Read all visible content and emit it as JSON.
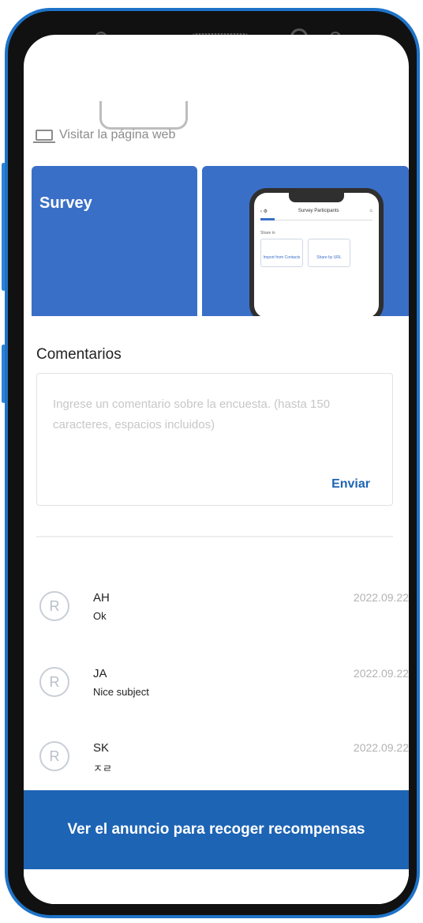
{
  "colors": {
    "accent": "#1d64b4",
    "card": "#3a6fc8",
    "frame": "#1e73c8"
  },
  "header": {
    "visit_link": "Visitar la página web"
  },
  "cards": {
    "survey_title": "Survey",
    "preview": {
      "title": "Survey Participants",
      "share_in": "Share in",
      "import_label": "Import from Contacts",
      "url_label": "Share by URL"
    }
  },
  "comments_section": {
    "title": "Comentarios",
    "placeholder": "Ingrese un comentario sobre la encuesta. (hasta 150 caracteres, espacios incluidos)",
    "send_label": "Enviar"
  },
  "comments": [
    {
      "avatar": "R",
      "name": "AH",
      "text": "Ok",
      "date": "2022.09.22"
    },
    {
      "avatar": "R",
      "name": "JA",
      "text": "Nice subject",
      "date": "2022.09.22"
    },
    {
      "avatar": "R",
      "name": "SK",
      "text": "ㅈㄹ",
      "date": "2022.09.22"
    }
  ],
  "cta": {
    "label": "Ver el anuncio para recoger recompensas"
  }
}
